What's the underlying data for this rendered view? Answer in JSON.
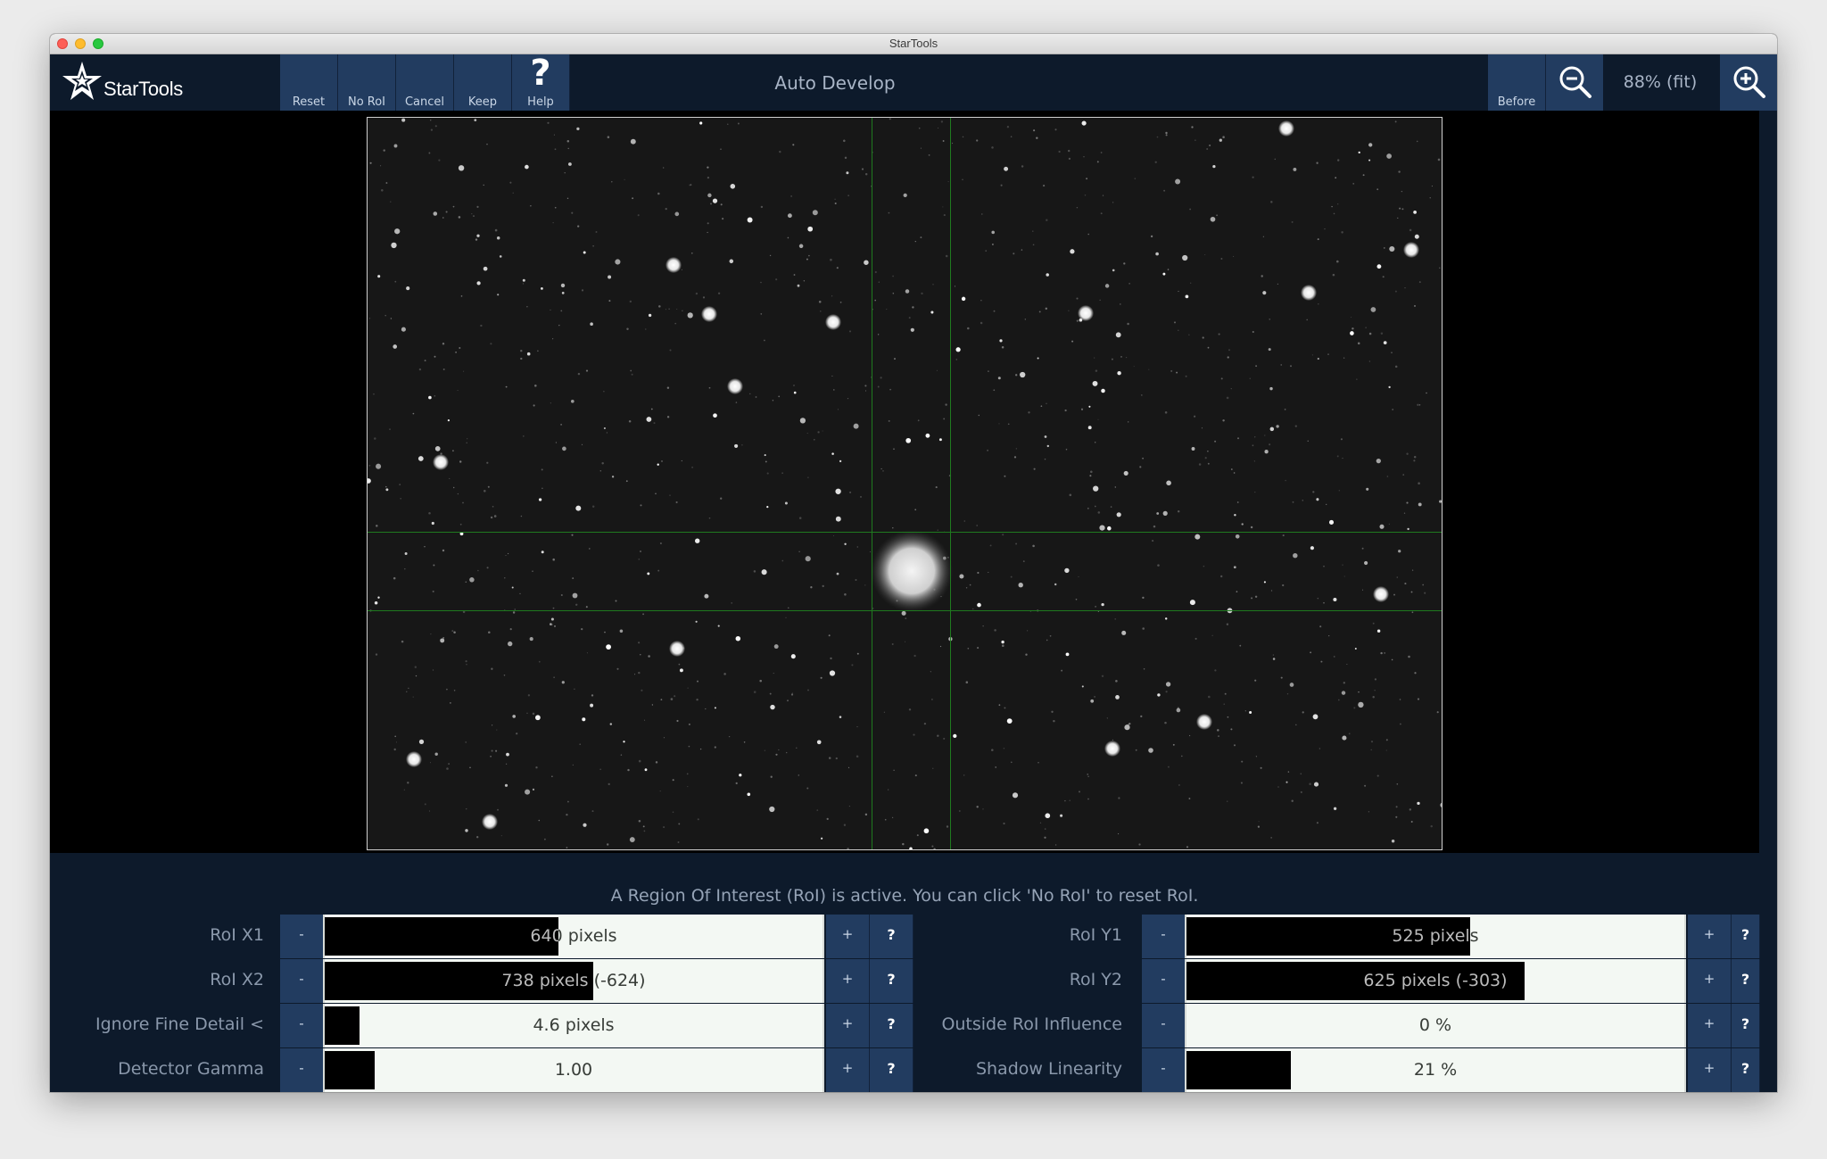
{
  "window": {
    "title": "StarTools"
  },
  "toolbar": {
    "logo_text": "StarTools",
    "buttons": {
      "reset": "Reset",
      "no_roi": "No RoI",
      "cancel": "Cancel",
      "keep": "Keep",
      "help": "Help",
      "help_glyph": "?",
      "before": "Before"
    },
    "tool_title": "Auto Develop",
    "zoom_level": "88% (fit)"
  },
  "panel": {
    "info": "A Region Of Interest (RoI) is active. You can click 'No RoI' to reset RoI.",
    "minus": "-",
    "plus": "+",
    "help": "?",
    "left_params": [
      {
        "label": "RoI X1",
        "value": "640 pixels",
        "fill": 0.47
      },
      {
        "label": "RoI X2",
        "value": "738 pixels (-624)",
        "fill": 0.54
      },
      {
        "label": "Ignore Fine Detail <",
        "value": "4.6 pixels",
        "fill": 0.07
      },
      {
        "label": "Detector Gamma",
        "value": "1.00",
        "fill": 0.1
      }
    ],
    "right_params": [
      {
        "label": "RoI Y1",
        "value": "525 pixels",
        "fill": 0.57
      },
      {
        "label": "RoI Y2",
        "value": "625 pixels (-303)",
        "fill": 0.68
      },
      {
        "label": "Outside RoI Influence",
        "value": "0 %",
        "fill": 0.0
      },
      {
        "label": "Shadow Linearity",
        "value": "21 %",
        "fill": 0.21
      }
    ]
  },
  "icons": {
    "logo": "star-logo-icon",
    "zoom_out": "zoom-out-icon",
    "zoom_in": "zoom-in-icon"
  },
  "colors": {
    "toolbar_bg": "#0d1a2b",
    "button_bg": "#223c60",
    "roi_line": "#1f7a1f",
    "slider_bg": "#f3f8f3"
  }
}
